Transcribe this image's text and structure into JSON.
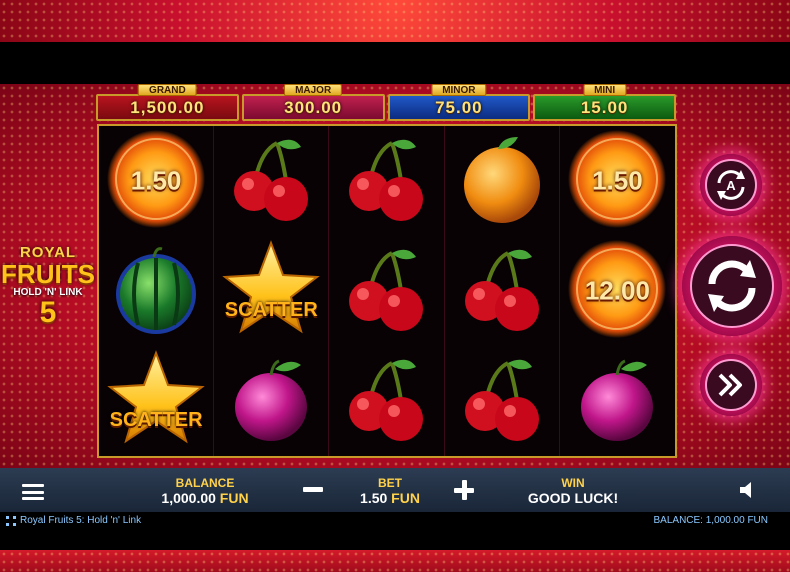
{
  "game": {
    "logo": {
      "line1": "ROYAL",
      "line2": "FRUITS",
      "line3": "HOLD 'N' LINK",
      "line4": "5"
    }
  },
  "jackpots": [
    {
      "label": "GRAND",
      "value": "1,500.00"
    },
    {
      "label": "MAJOR",
      "value": "300.00"
    },
    {
      "label": "MINOR",
      "value": "75.00"
    },
    {
      "label": "MINI",
      "value": "15.00"
    }
  ],
  "reels": {
    "rows": [
      [
        "sun",
        "cherry",
        "cherry",
        "orange",
        "sun"
      ],
      [
        "watermelon",
        "scatter",
        "cherry",
        "cherry",
        "sun"
      ],
      [
        "scatter",
        "plum",
        "cherry",
        "cherry",
        "plum"
      ]
    ],
    "sun_values": {
      "r0c0": "1.50",
      "r0c4": "1.50",
      "r1c4": "12.00"
    },
    "scatter_text": "SCATTER"
  },
  "controls": {
    "autoplay_icon": "autoplay-icon",
    "autoplay_letter": "A",
    "spin_icon": "spin-icon",
    "turbo_icon": "fast-forward-icon"
  },
  "bottom_bar": {
    "balance_label": "BALANCE",
    "balance_value": "1,000.00",
    "bet_label": "BET",
    "bet_value": "1.50",
    "currency": "FUN",
    "win_label": "WIN",
    "win_value": "GOOD LUCK!"
  },
  "status_bar": {
    "game_title": "Royal Fruits 5: Hold 'n' Link",
    "balance_text": "BALANCE: 1,000.00 FUN"
  },
  "colors": {
    "accent_gold": "#ffd24a",
    "background_red": "#c8102e",
    "button_pink": "#ff2a7a",
    "bar_navy": "#1a2638"
  }
}
